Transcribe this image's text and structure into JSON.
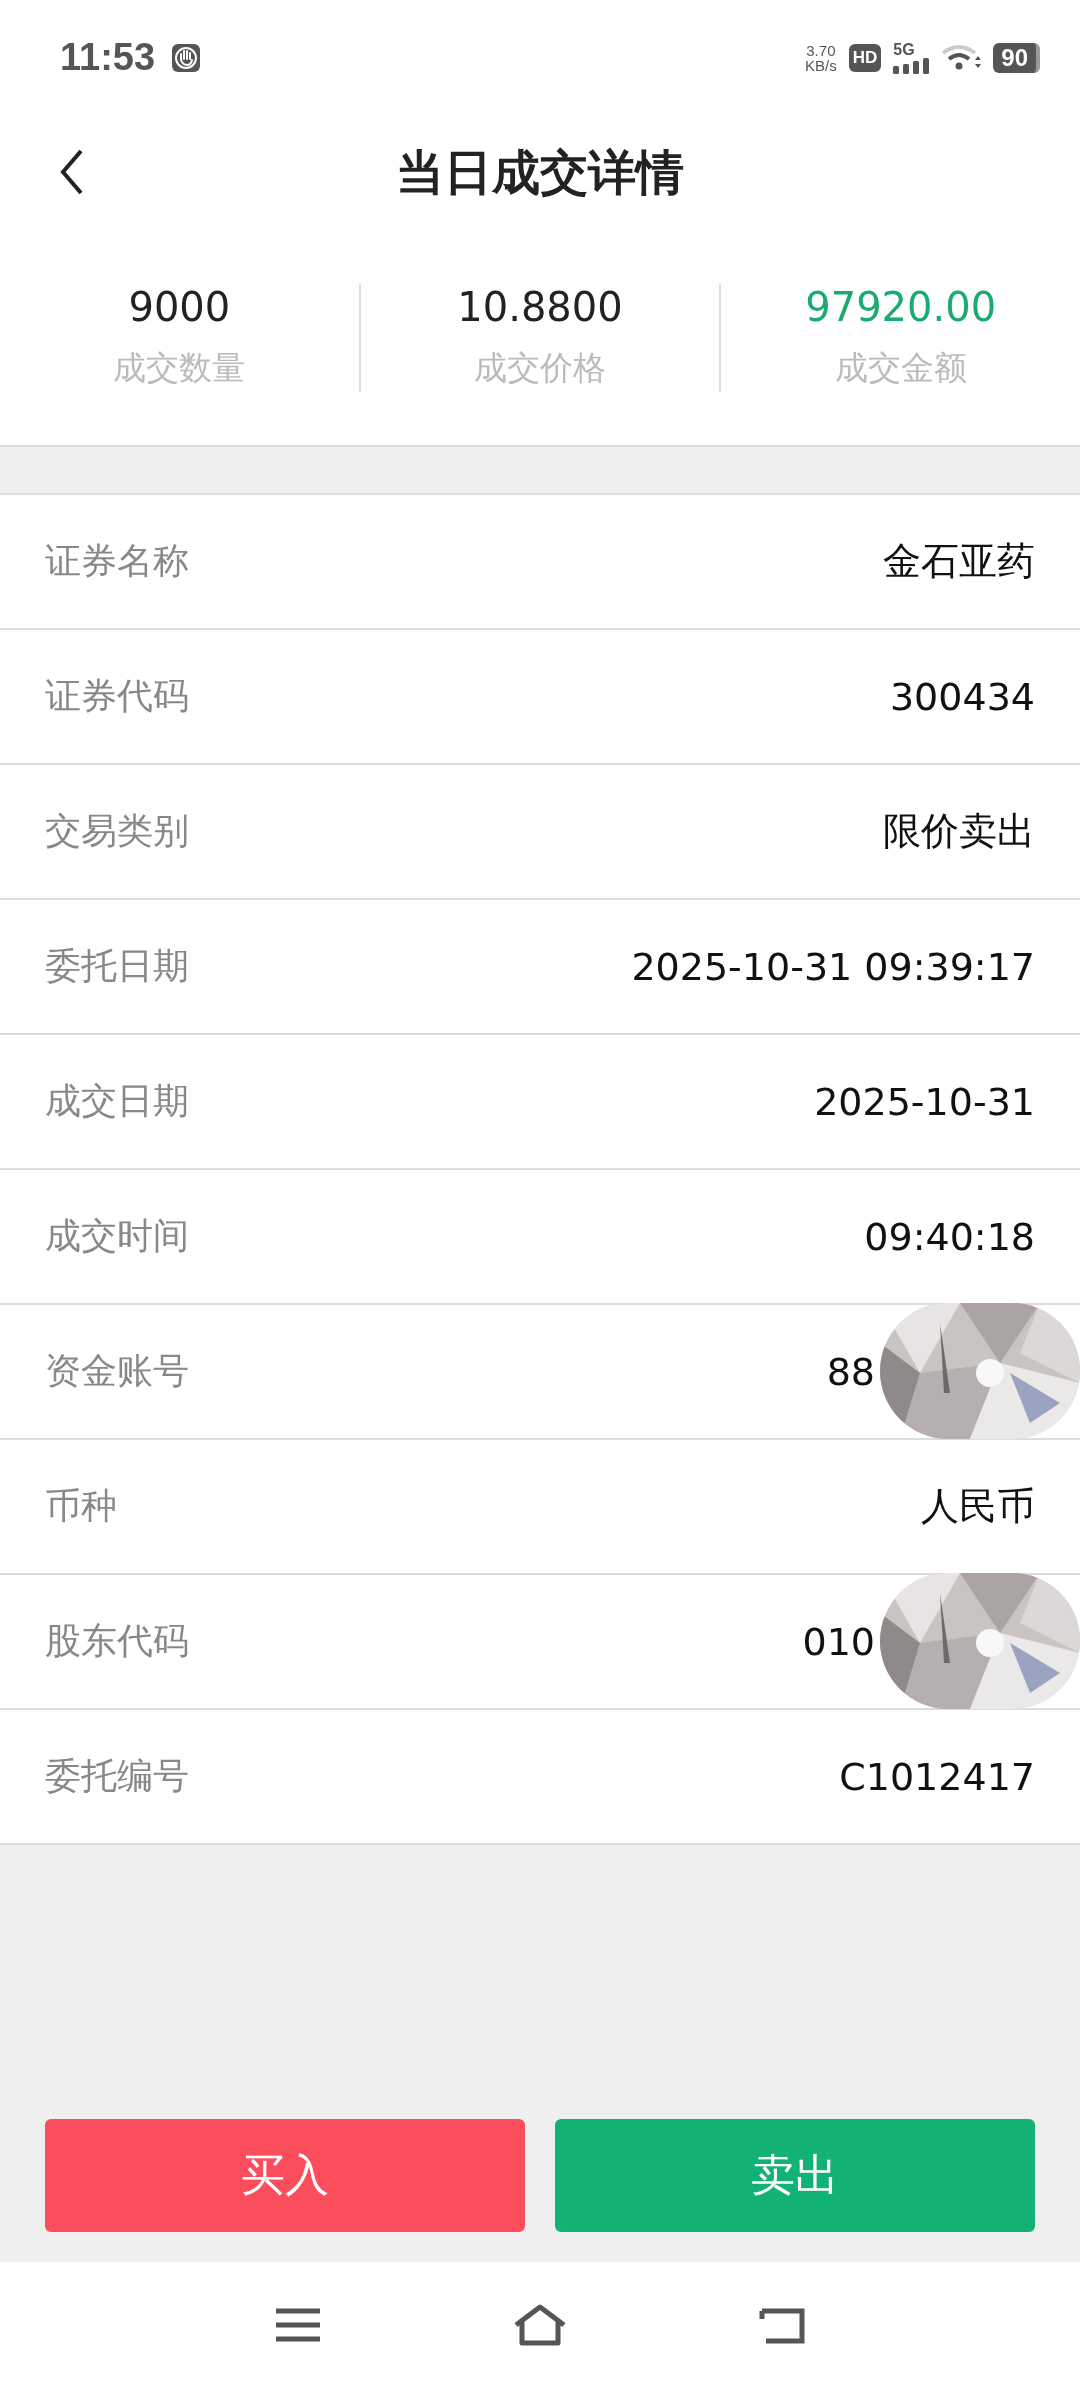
{
  "status_bar": {
    "time": "11:53",
    "net_speed": "3.70",
    "net_unit": "KB/s",
    "hd": "HD",
    "network": "5G",
    "battery": "90"
  },
  "header": {
    "title": "当日成交详情"
  },
  "summary": [
    {
      "value": "9000",
      "label": "成交数量",
      "highlight": false
    },
    {
      "value": "10.8800",
      "label": "成交价格",
      "highlight": false
    },
    {
      "value": "97920.00",
      "label": "成交金额",
      "highlight": true
    }
  ],
  "details": [
    {
      "label": "证券名称",
      "value": "金石亚药"
    },
    {
      "label": "证券代码",
      "value": "300434"
    },
    {
      "label": "交易类别",
      "value": "限价卖出"
    },
    {
      "label": "委托日期",
      "value": "2025-10-31 09:39:17"
    },
    {
      "label": "成交日期",
      "value": "2025-10-31"
    },
    {
      "label": "成交时间",
      "value": "09:40:18"
    },
    {
      "label": "资金账号",
      "value": "88",
      "covered": true
    },
    {
      "label": "币种",
      "value": "人民币"
    },
    {
      "label": "股东代码",
      "value": "010",
      "covered": true
    },
    {
      "label": "委托编号",
      "value": "C1012417"
    }
  ],
  "buttons": [
    {
      "label": "买入",
      "kind": "buy"
    },
    {
      "label": "卖出",
      "kind": "sell"
    }
  ]
}
